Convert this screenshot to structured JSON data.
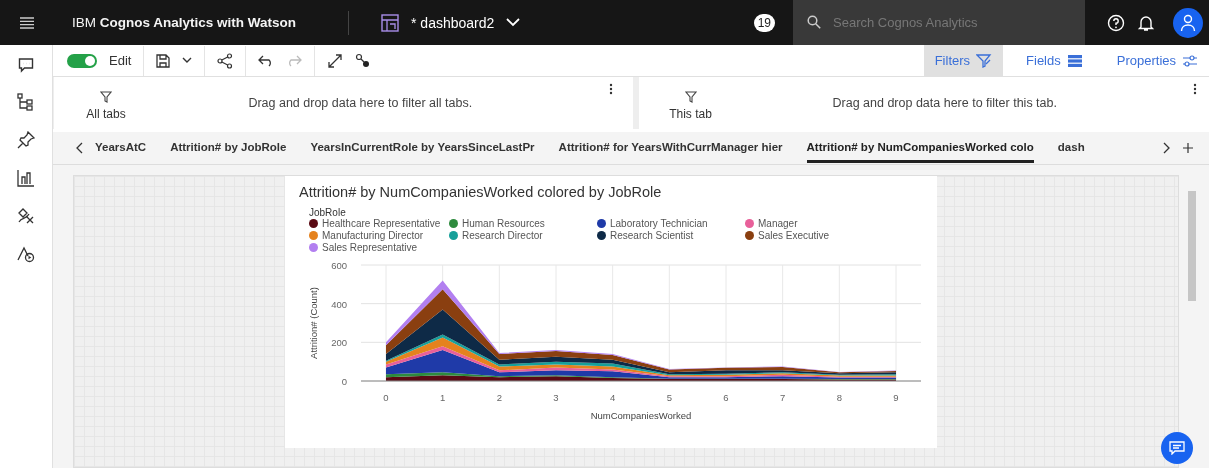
{
  "topbar": {
    "title": "IBM **Cognos Analytics with Watson**",
    "dashboard": "* dashboard2",
    "badge": "19",
    "search": {
      "placeholder": "Search Cognos Analytics"
    }
  },
  "toolbar": {
    "edit": {
      "label": "Edit",
      "on": true
    },
    "redo_disabled": true,
    "panels": [
      {
        "label": "Filters",
        "selected": true
      },
      {
        "label": "Fields",
        "selected": false
      },
      {
        "label": "Properties",
        "selected": false
      }
    ]
  },
  "filters": [
    {
      "scope": "All tabs",
      "hint": "Drag and drop data here to filter all tabs."
    },
    {
      "scope": "This tab",
      "hint": "Drag and drop data here to filter this tab."
    }
  ],
  "tabs": [
    {
      "label": "YearsAtC",
      "selected": false
    },
    {
      "label": "Attrition# by JobRole",
      "selected": false
    },
    {
      "label": "YearsInCurrentRole by YearsSinceLastPr",
      "selected": false
    },
    {
      "label": "Attrition# for YearsWithCurrManager hier",
      "selected": false
    },
    {
      "label": "Attrition# by NumCompaniesWorked colo",
      "selected": true
    },
    {
      "label": "dash",
      "selected": false
    }
  ],
  "widget": {
    "title": "Attrition# by NumCompaniesWorked colored by JobRole",
    "legend_title": "JobRole",
    "chart_data": {
      "type": "area",
      "stacked": true,
      "grid": true,
      "xlabel": "NumCompaniesWorked",
      "ylabel": "Attrition# (Count)",
      "x": [
        "0",
        "1",
        "2",
        "3",
        "4",
        "5",
        "6",
        "7",
        "8",
        "9"
      ],
      "ylim": [
        0,
        600
      ],
      "yticks": [
        0,
        200,
        400,
        600
      ],
      "series": [
        {
          "name": "Healthcare Representative",
          "color": "#5a0a14",
          "values": [
            20,
            30,
            20,
            25,
            15,
            10,
            10,
            10,
            8,
            8
          ]
        },
        {
          "name": "Human Resources",
          "color": "#2e8b3e",
          "values": [
            15,
            15,
            5,
            5,
            5,
            2,
            2,
            2,
            2,
            2
          ]
        },
        {
          "name": "Laboratory Technician",
          "color": "#1f3aa8",
          "values": [
            35,
            115,
            20,
            25,
            30,
            8,
            8,
            13,
            8,
            8
          ]
        },
        {
          "name": "Manager",
          "color": "#e8609a",
          "values": [
            15,
            20,
            10,
            15,
            10,
            5,
            5,
            7,
            4,
            4
          ]
        },
        {
          "name": "Manufacturing Director",
          "color": "#e5821e",
          "values": [
            15,
            45,
            20,
            15,
            15,
            5,
            7,
            8,
            6,
            6
          ]
        },
        {
          "name": "Research Director",
          "color": "#17a09a",
          "values": [
            5,
            15,
            10,
            15,
            15,
            5,
            6,
            5,
            4,
            7
          ]
        },
        {
          "name": "Research Scientist",
          "color": "#0e2a47",
          "values": [
            35,
            130,
            25,
            25,
            20,
            10,
            17,
            10,
            8,
            10
          ]
        },
        {
          "name": "Sales Executive",
          "color": "#8a3f10",
          "values": [
            45,
            105,
            30,
            30,
            25,
            15,
            13,
            17,
            5,
            7
          ]
        },
        {
          "name": "Sales Representative",
          "color": "#b27ff0",
          "values": [
            15,
            45,
            5,
            5,
            5,
            2,
            2,
            3,
            2,
            2
          ]
        }
      ]
    }
  }
}
